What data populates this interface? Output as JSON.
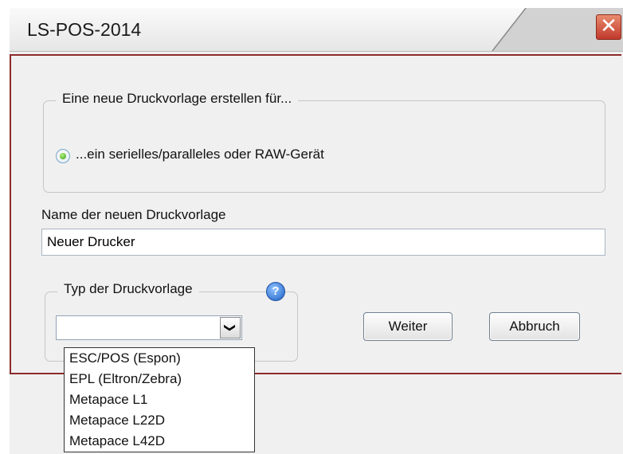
{
  "window": {
    "title": "LS-POS-2014",
    "close_symbol": "✕"
  },
  "group_create": {
    "caption": "Eine neue Druckvorlage erstellen für...",
    "radio_option": {
      "label": "...ein serielles/paralleles oder RAW-Gerät",
      "selected": true
    }
  },
  "name_field": {
    "label": "Name der neuen Druckvorlage",
    "value": "Neuer Drucker"
  },
  "group_type": {
    "caption": "Typ der Druckvorlage",
    "help_icon": "help-icon",
    "help_symbol": "?",
    "combo_value": "",
    "combo_arrow": "❯",
    "options": [
      "ESC/POS (Espon)",
      "EPL (Eltron/Zebra)",
      "Metapace L1",
      "Metapace L22D",
      "Metapace L42D"
    ]
  },
  "buttons": {
    "next_label": "Weiter",
    "cancel_label": "Abbruch"
  },
  "colors": {
    "accent_border": "#8b2a2a",
    "close_button": "#c1392b",
    "radio_selected": "#2e9a1a",
    "help_icon": "#1c5fc4"
  }
}
